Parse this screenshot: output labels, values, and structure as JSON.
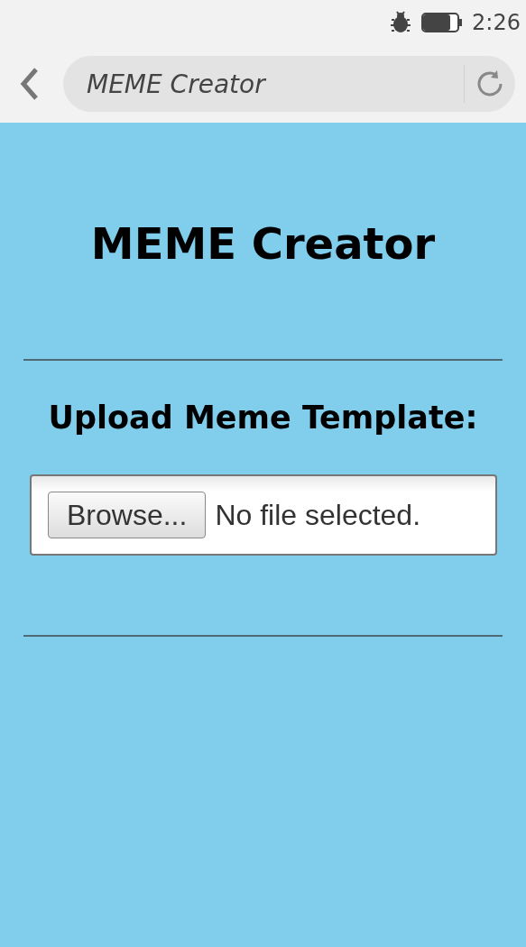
{
  "status_bar": {
    "time": "2:26"
  },
  "address_bar": {
    "title": "MEME Creator"
  },
  "page": {
    "title": "MEME Creator",
    "upload_label": "Upload Meme Template:",
    "file_input": {
      "button": "Browse...",
      "status": "No file selected."
    }
  }
}
